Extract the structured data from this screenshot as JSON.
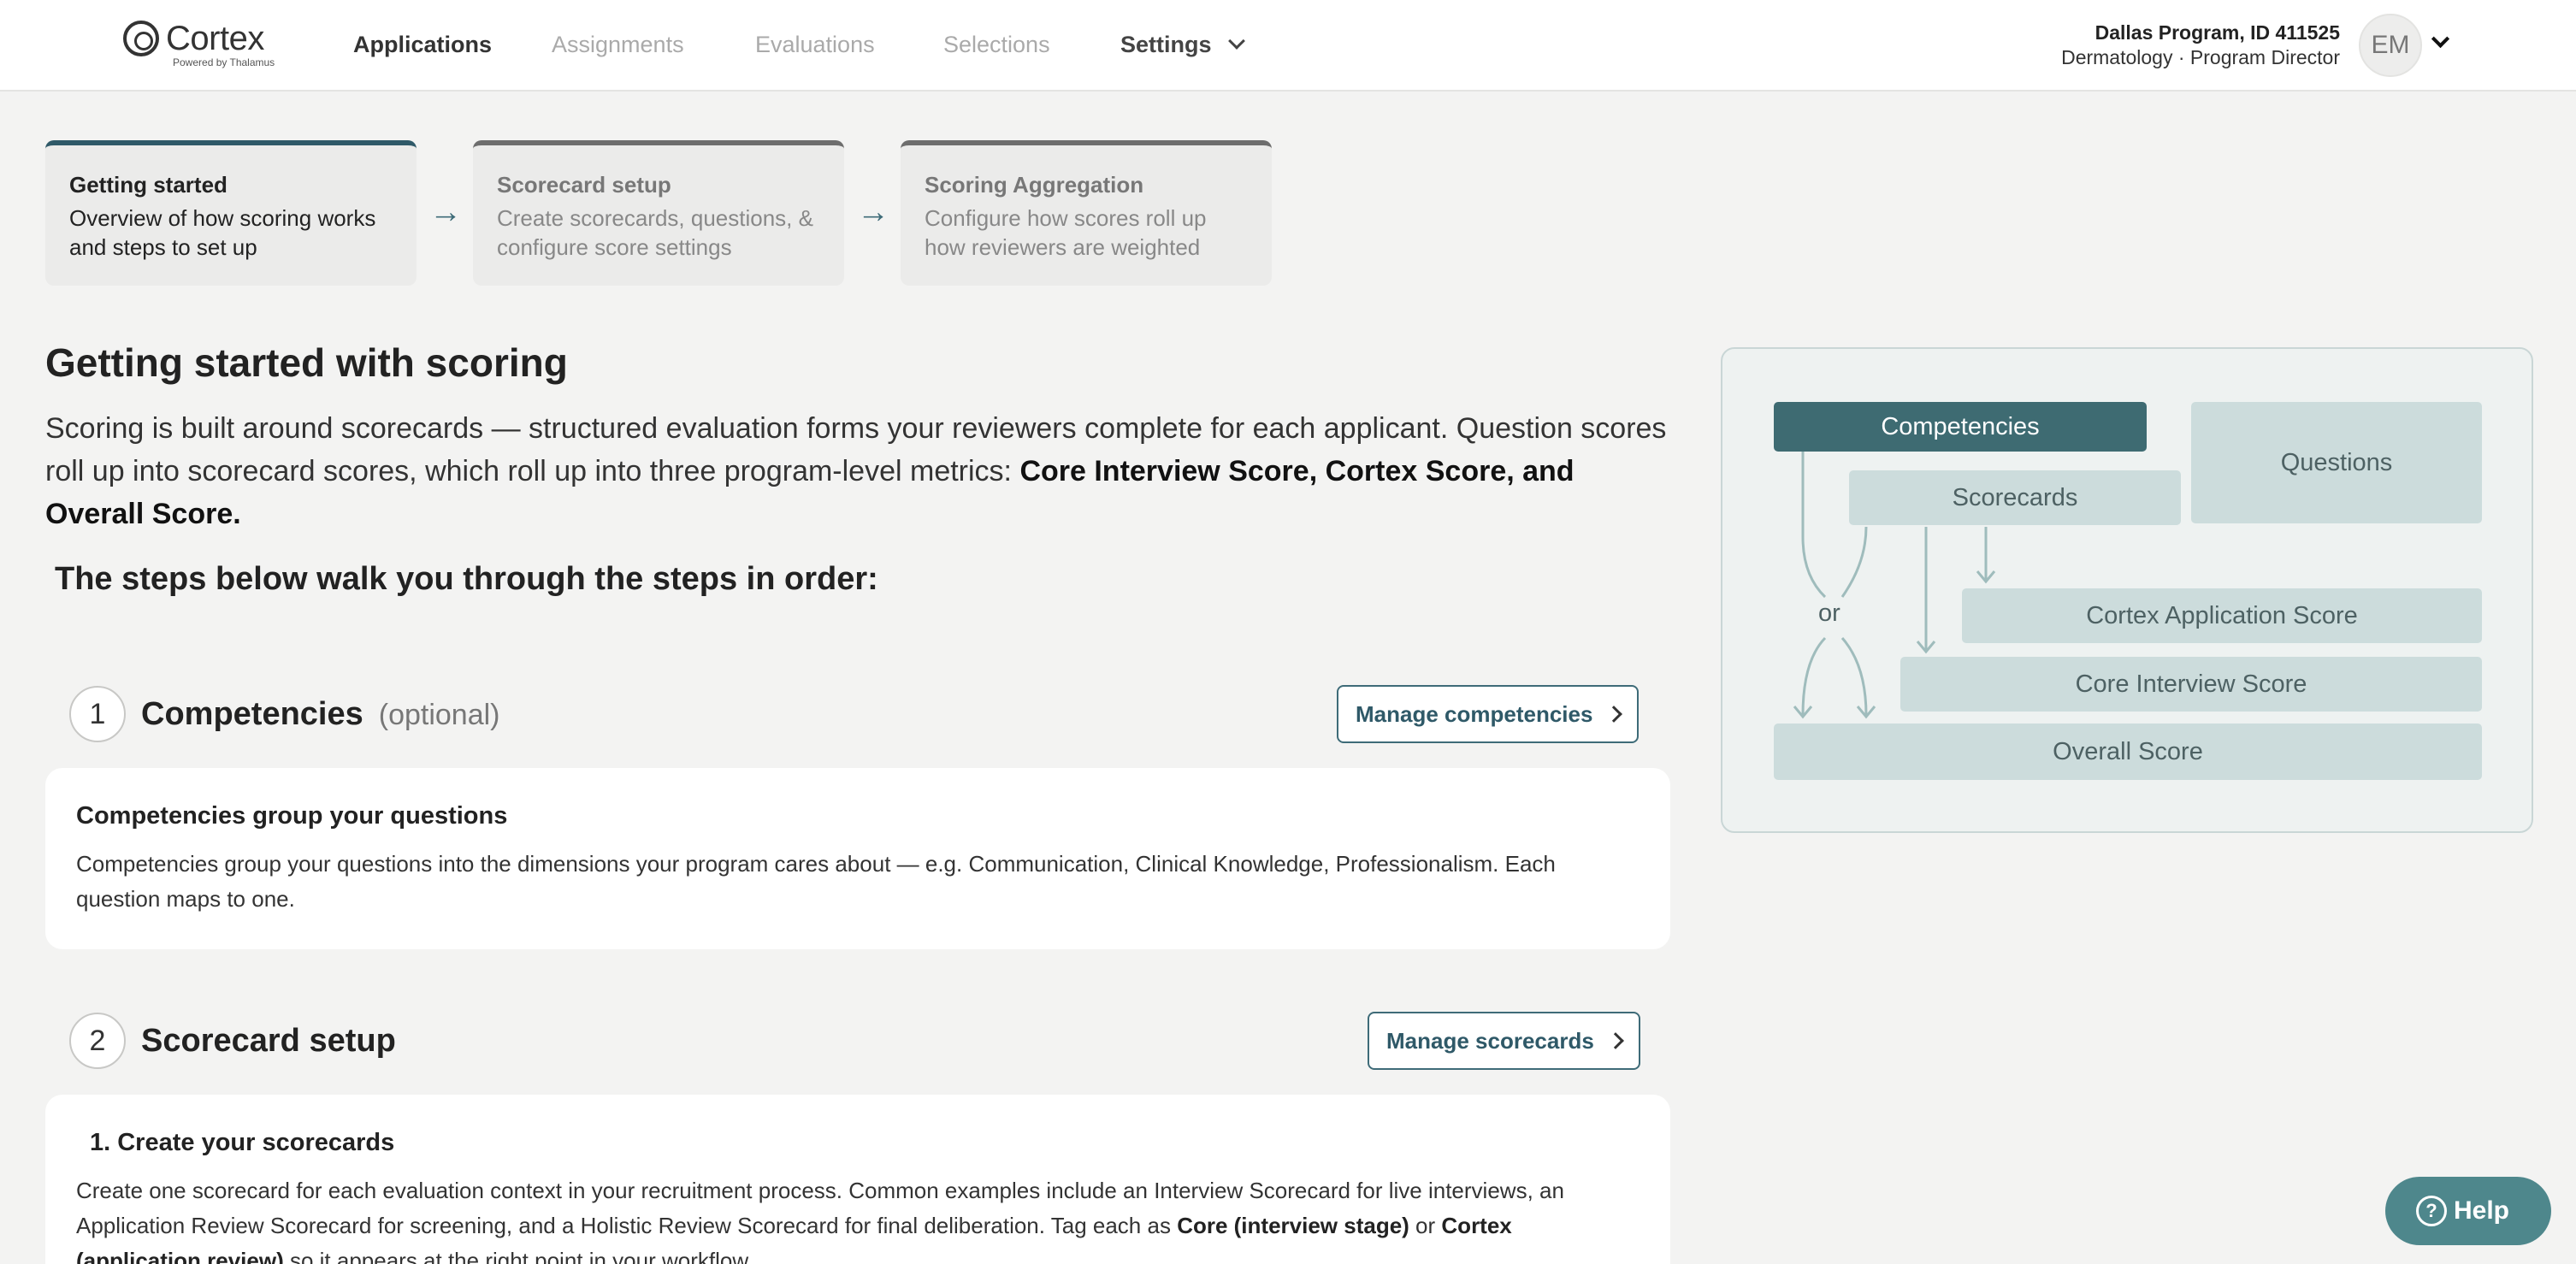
{
  "nav": {
    "brand": "Cortex",
    "brand_sub": "Powered by Thalamus",
    "items": [
      "Applications",
      "Assignments",
      "Evaluations",
      "Selections"
    ],
    "settings_label": "Settings",
    "user": {
      "program": "Dallas Program, ID 411525",
      "role": "Dermatology · Program Director",
      "initials": "EM"
    }
  },
  "steps": [
    {
      "title": "Getting started",
      "desc": "Overview of how scoring works and steps to set up"
    },
    {
      "title": "Scorecard setup",
      "desc": "Create scorecards, questions, & configure score settings"
    },
    {
      "title": "Scoring Aggregation",
      "desc": "Configure how scores roll up how reviewers are weighted"
    }
  ],
  "steps_arrow": "→",
  "main": {
    "title": "Getting started with scoring",
    "intro_plain": "Scoring is built around scorecards — structured evaluation forms your reviewers complete for each applicant. Question scores roll up into scorecard scores, which roll up into three program-level metrics: ",
    "intro_bold": "Core Interview Score, Cortex Score, and Overall Score.",
    "steps_heading": "The steps below walk you through the steps in order:"
  },
  "sections": [
    {
      "number": "1",
      "title": "Competencies",
      "optional": "(optional)",
      "button": "Manage competencies",
      "card_title": "Competencies group your questions",
      "card_text": "Competencies group your questions into the dimensions your program cares about — e.g. Communication, Clinical Knowledge, Professionalism. Each question maps to one."
    },
    {
      "number": "2",
      "title": "Scorecard setup",
      "button": "Manage scorecards",
      "card_title": "1. Create your scorecards",
      "card_text_1": "Create one scorecard for each evaluation context in your recruitment process. Common examples include an Interview Scorecard for live interviews, an Application Review Scorecard for screening, and a Holistic Review Scorecard for final deliberation. Tag each as ",
      "card_bold_1": "Core (interview stage)",
      "card_text_2": " or ",
      "card_bold_2": "Cortex (application review)",
      "card_text_3": " so it appears at the right point in your workflow."
    }
  ],
  "diagram": {
    "competencies": "Competencies",
    "questions": "Questions",
    "scorecards": "Scorecards",
    "or": "or",
    "cortex_score": "Cortex Application Score",
    "core_score": "Core Interview Score",
    "overall_score": "Overall Score"
  },
  "help": {
    "label": "Help",
    "icon": "?"
  },
  "colors": {
    "accent": "#2f5968",
    "diagram_dark": "#3e6b72",
    "diagram_light": "#ccdcdc",
    "help_button": "#4e878c",
    "page_bg": "#f3f3f2"
  }
}
